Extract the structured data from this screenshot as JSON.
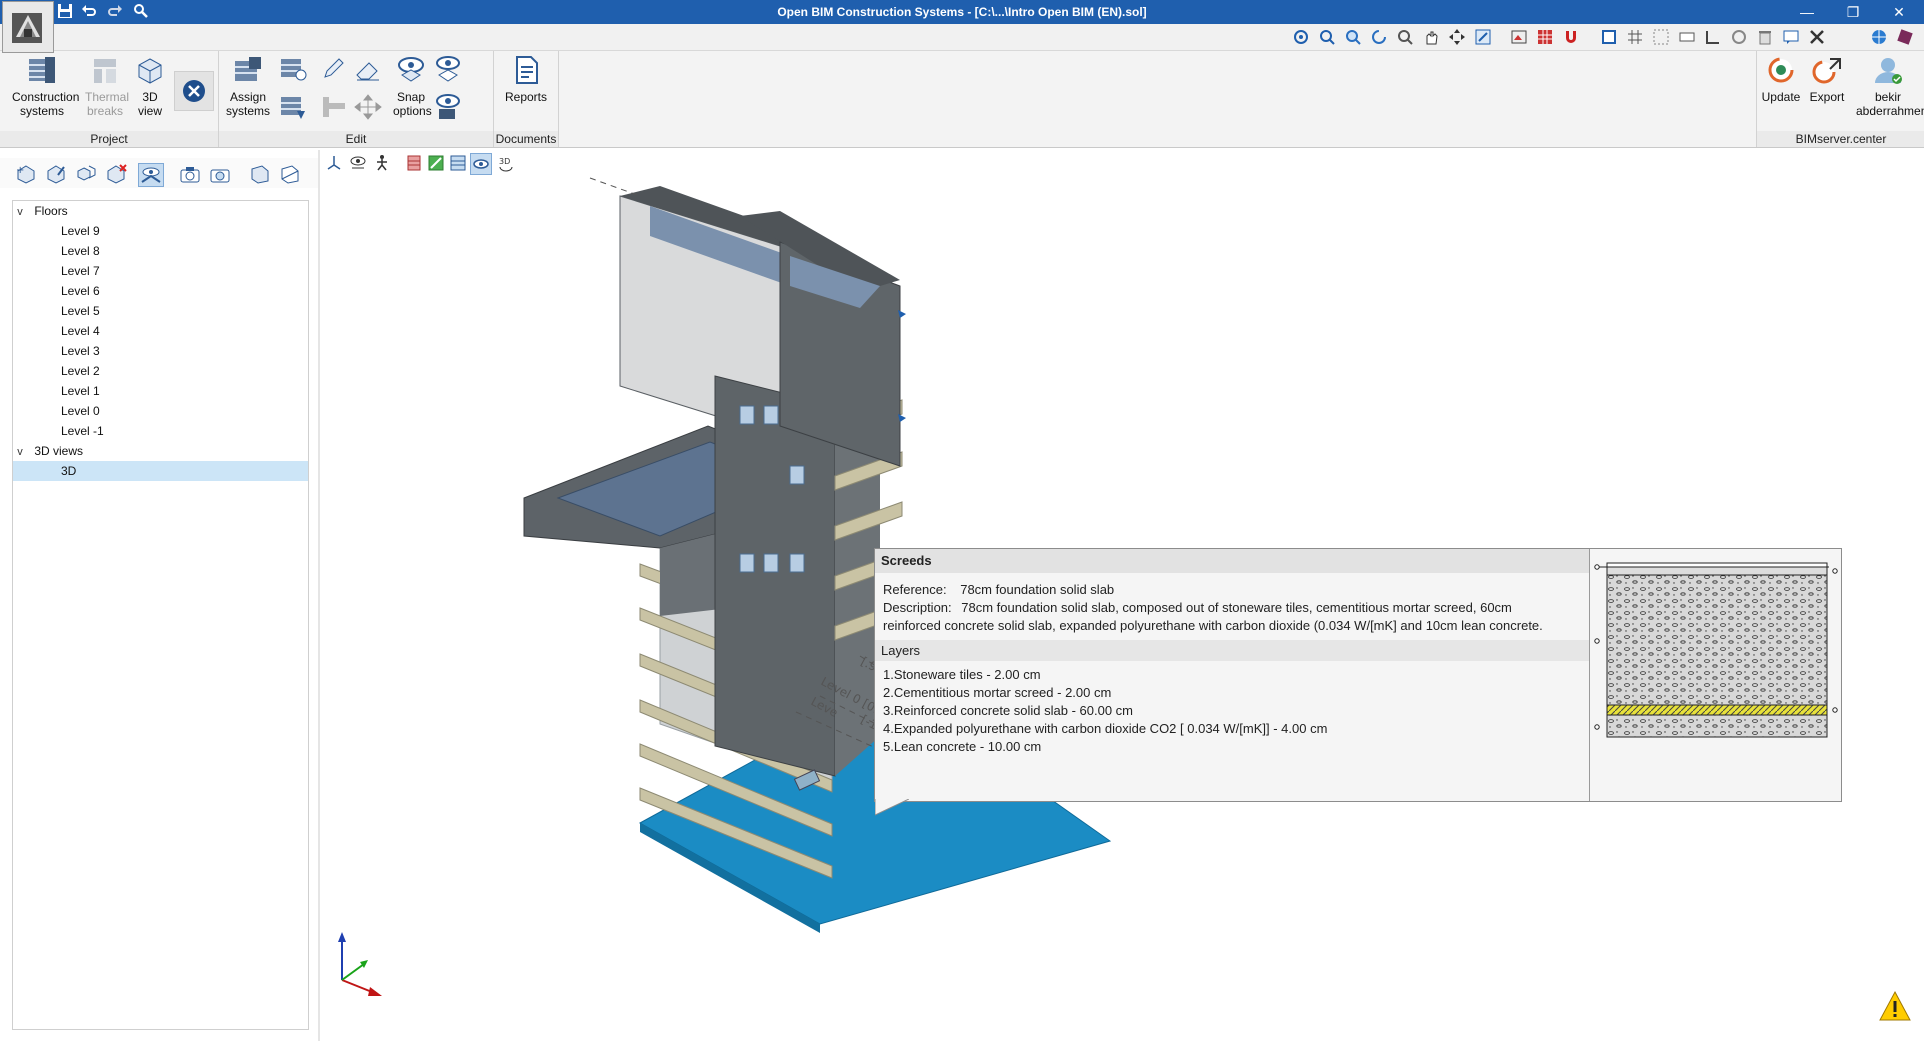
{
  "window": {
    "title": "Open BIM Construction Systems - [C:\\...\\Intro Open BIM (EN).sol]",
    "minimize": "—",
    "restore": "❐",
    "close": "✕"
  },
  "quick_access": {
    "save": "💾",
    "undo": "↶",
    "redo": "↷",
    "search": "🔍"
  },
  "ribbon": {
    "project": {
      "label": "Project",
      "construction_systems": "Construction systems",
      "thermal_breaks": "Thermal breaks",
      "view3d": "3D view"
    },
    "edit": {
      "label": "Edit",
      "assign_systems": "Assign systems",
      "snap_options": "Snap options"
    },
    "documents": {
      "label": "Documents",
      "reports": "Reports"
    },
    "bimserver": {
      "label": "BIMserver.center",
      "update": "Update",
      "export": "Export",
      "user": "bekir abderrahmen"
    }
  },
  "tree": {
    "floors_label": "Floors",
    "levels": [
      "Level 9",
      "Level 8",
      "Level 7",
      "Level 6",
      "Level 5",
      "Level 4",
      "Level 3",
      "Level 2",
      "Level 1",
      "Level 0",
      "Level -1"
    ],
    "views_label": "3D views",
    "views": [
      "3D"
    ]
  },
  "viewport": {
    "level_labels": [
      "[.95 m]",
      "Level 0 [0.00 m]",
      "Leve",
      "[-1.45 m]"
    ]
  },
  "tooltip": {
    "title": "Screeds",
    "reference_label": "Reference:",
    "reference_value": "78cm foundation solid slab",
    "description_label": "Description:",
    "description_line1": "78cm foundation solid slab, composed out of stoneware tiles, cementitious mortar screed, 60cm",
    "description_line2": "reinforced concrete solid slab, expanded polyurethane with carbon dioxide (0.034 W/[mK] and 10cm lean concrete.",
    "layers_label": "Layers",
    "layers": [
      "1.Stoneware tiles - 2.00 cm",
      "2.Cementitious mortar screed - 2.00 cm",
      "3.Reinforced concrete solid slab - 60.00 cm",
      "4.Expanded polyurethane with carbon dioxide CO2 [ 0.034 W/[mK]] - 4.00 cm",
      "5.Lean concrete - 10.00 cm"
    ]
  },
  "colors": {
    "titlebar": "#1f5fae",
    "selection": "#cce5f7",
    "slab": "#1b8cc4"
  }
}
